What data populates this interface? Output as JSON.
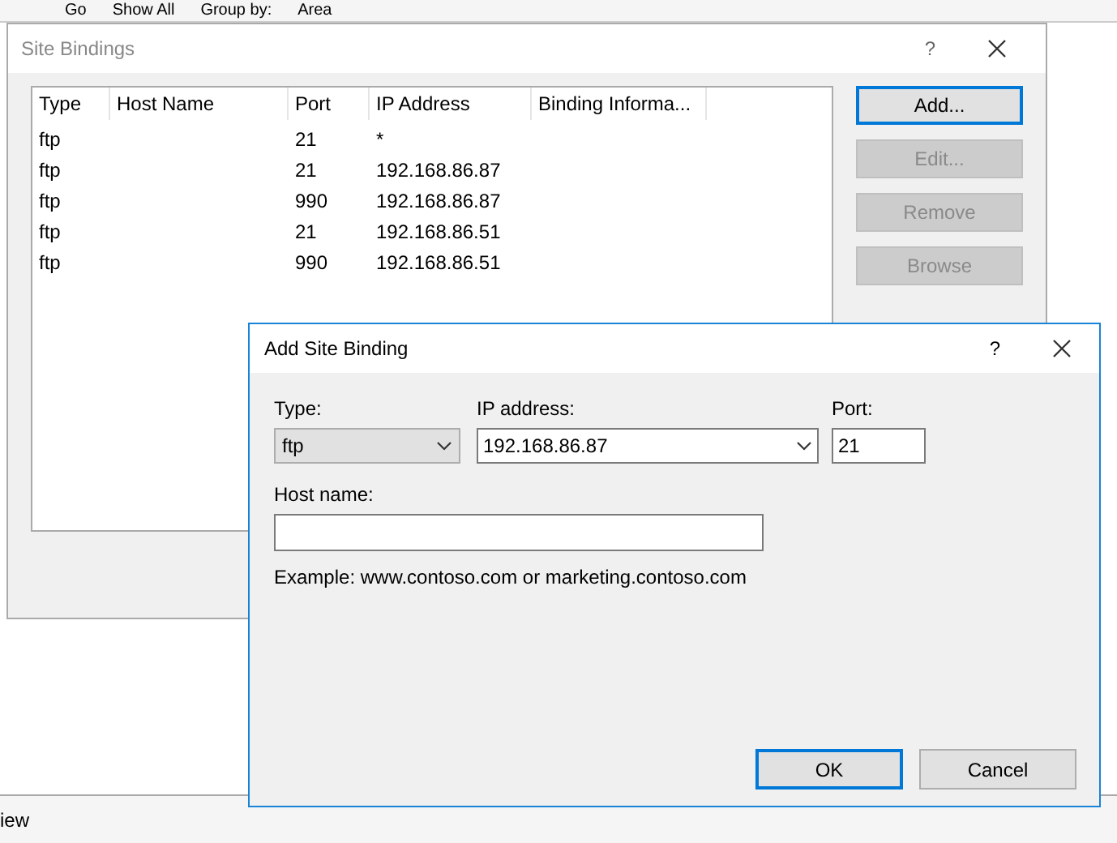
{
  "background_toolbar": {
    "items": [
      "Go",
      "Show All",
      "Group by:",
      "Area"
    ]
  },
  "background_status": {
    "text": "iew"
  },
  "site_bindings": {
    "title": "Site Bindings",
    "help": "?",
    "columns": [
      "Type",
      "Host Name",
      "Port",
      "IP Address",
      "Binding Informa..."
    ],
    "rows": [
      {
        "cells": [
          "ftp",
          "",
          "21",
          "*",
          ""
        ]
      },
      {
        "cells": [
          "ftp",
          "",
          "21",
          "192.168.86.87",
          ""
        ]
      },
      {
        "cells": [
          "ftp",
          "",
          "990",
          "192.168.86.87",
          ""
        ]
      },
      {
        "cells": [
          "ftp",
          "",
          "21",
          "192.168.86.51",
          ""
        ]
      },
      {
        "cells": [
          "ftp",
          "",
          "990",
          "192.168.86.51",
          ""
        ]
      }
    ],
    "buttons": [
      {
        "label": "Add...",
        "disabled": false,
        "focused": true
      },
      {
        "label": "Edit...",
        "disabled": true,
        "focused": false
      },
      {
        "label": "Remove",
        "disabled": true,
        "focused": false
      },
      {
        "label": "Browse",
        "disabled": true,
        "focused": false
      }
    ]
  },
  "add_site_binding": {
    "title": "Add Site Binding",
    "help": "?",
    "type": {
      "label": "Type:",
      "value": "ftp"
    },
    "ip_address": {
      "label": "IP address:",
      "value": "192.168.86.87"
    },
    "port": {
      "label": "Port:",
      "value": "21"
    },
    "host_name": {
      "label": "Host name:"
    },
    "example": "Example: www.contoso.com or marketing.contoso.com",
    "buttons": [
      {
        "label": "OK",
        "focused": true
      },
      {
        "label": "Cancel",
        "focused": false
      }
    ]
  }
}
